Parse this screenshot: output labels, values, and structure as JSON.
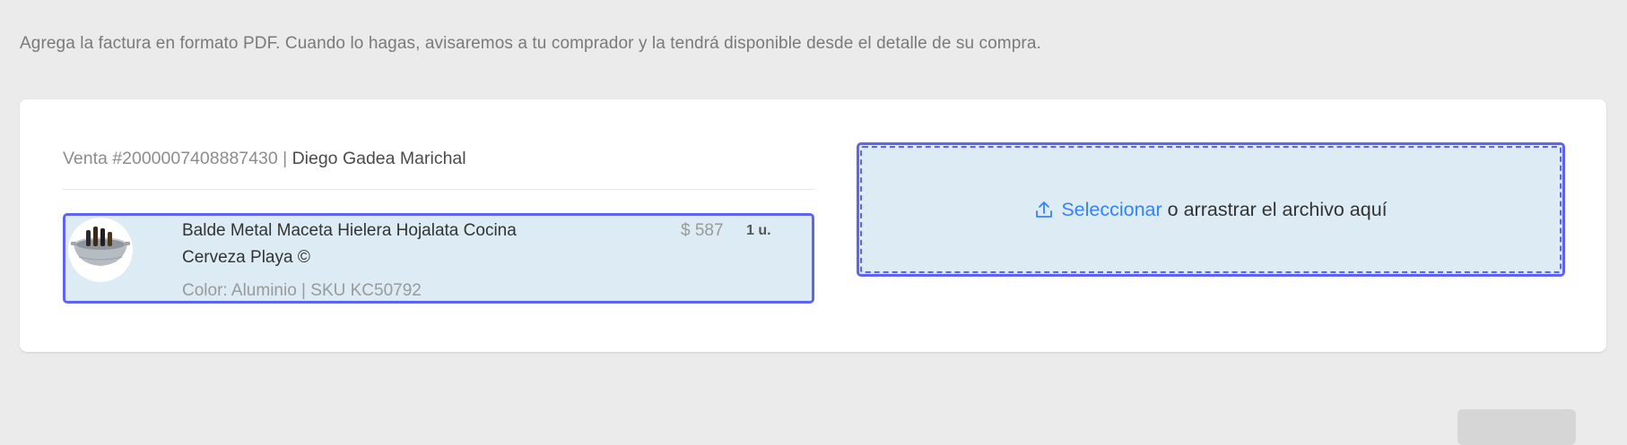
{
  "page": {
    "instructions": "Agrega la factura en formato PDF. Cuando lo hagas, avisaremos a tu comprador y la tendrá disponible desde el detalle de su compra."
  },
  "sale": {
    "label": "Venta #2000007408887430",
    "separator": " | ",
    "buyer_name": "Diego Gadea Marichal"
  },
  "product": {
    "title": "Balde Metal Maceta Hielera Hojalata Cocina Cerveza Playa ©",
    "price": "$ 587",
    "quantity": "1 u.",
    "attributes": "Color: Aluminio | SKU KC50792",
    "thumbnail_icon": "metal-ice-bucket-image"
  },
  "upload": {
    "icon": "upload-icon",
    "link_label": "Seleccionar",
    "rest_label": "o arrastrar el archivo aquí"
  },
  "colors": {
    "accent": "#5f63f2",
    "link": "#3483fa",
    "highlight_bg": "#dcebf4",
    "page_bg": "#ebebeb"
  }
}
